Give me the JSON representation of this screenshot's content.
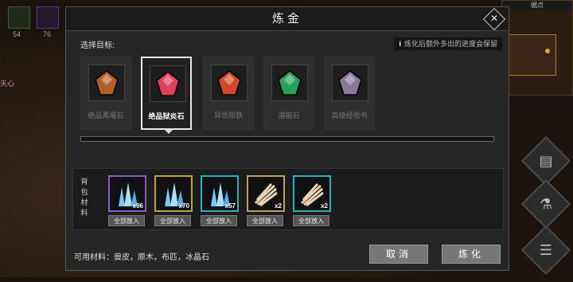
{
  "hud": {
    "slot1_count": "54",
    "slot2_count": "76",
    "side_text": "天心"
  },
  "minimap": {
    "title": "据点"
  },
  "dialog": {
    "title": "炼金",
    "close_glyph": "✕",
    "target_label": "选择目标:",
    "hint_mark": "i",
    "hint_text": "炼化后额外多出的进度会保留",
    "targets": [
      {
        "label": "绝品黑曜石",
        "color": "#b0602a",
        "selected": false
      },
      {
        "label": "绝品狱炎石",
        "color": "#e0405a",
        "selected": true
      },
      {
        "label": "异世陨铁",
        "color": "#d04a2a",
        "selected": false
      },
      {
        "label": "潜能石",
        "color": "#2aa060",
        "selected": false
      },
      {
        "label": "高级经验书",
        "color": "#8a7a9a",
        "selected": false
      }
    ],
    "progress": 0,
    "bag_label": "背包材料",
    "materials": [
      {
        "count": "x96",
        "border": "#8a5ad0",
        "kind": "crystal",
        "button": "全部放入"
      },
      {
        "count": "x70",
        "border": "#c0a040",
        "kind": "crystal",
        "button": "全部放入"
      },
      {
        "count": "x57",
        "border": "#2ab0c0",
        "kind": "crystal",
        "button": "全部放入"
      },
      {
        "count": "x2",
        "border": "#c0a060",
        "kind": "fiber",
        "button": "全部放入"
      },
      {
        "count": "x2",
        "border": "#2ab0c0",
        "kind": "fiber",
        "button": "全部放入"
      }
    ],
    "available": "可用材料：兽皮，原木，布匹，冰晶石",
    "cancel_label": "取消",
    "confirm_label": "炼化"
  }
}
